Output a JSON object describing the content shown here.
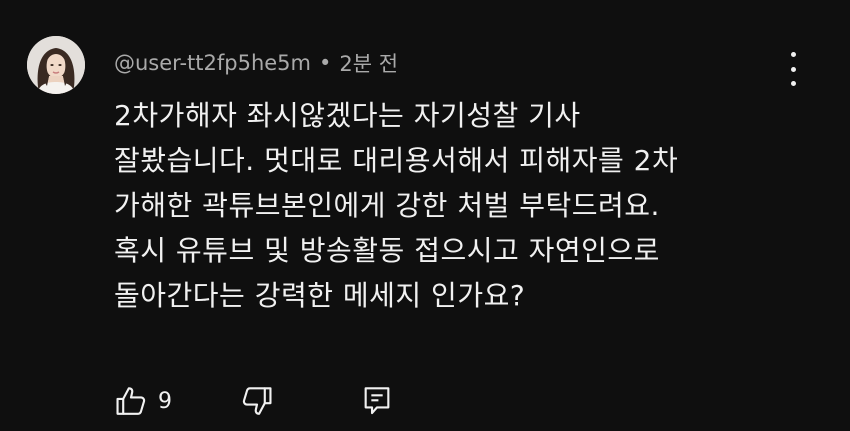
{
  "comment": {
    "username": "@user-tt2fp5he5m",
    "separator": "•",
    "time": "2분 전",
    "lines": [
      "2차가해자 좌시않겠다는 자기성찰 기사",
      "잘봤습니다. 멋대로 대리용서해서 피해자를 2차",
      "가해한 곽튜브본인에게 강한 처벌 부탁드려요.",
      "혹시 유튜브 및 방송활동 접으시고 자연인으로",
      "돌아간다는 강력한 메세지 인가요?"
    ],
    "like_count": "9"
  },
  "icons": {
    "avatar": "avatar-image",
    "more": "more-vert-icon",
    "like": "thumb-up-icon",
    "dislike": "thumb-down-icon",
    "reply": "reply-comment-icon"
  },
  "colors": {
    "background": "#0f0f0f",
    "text": "#f1f1f1",
    "secondary_text": "#aaaaaa"
  }
}
